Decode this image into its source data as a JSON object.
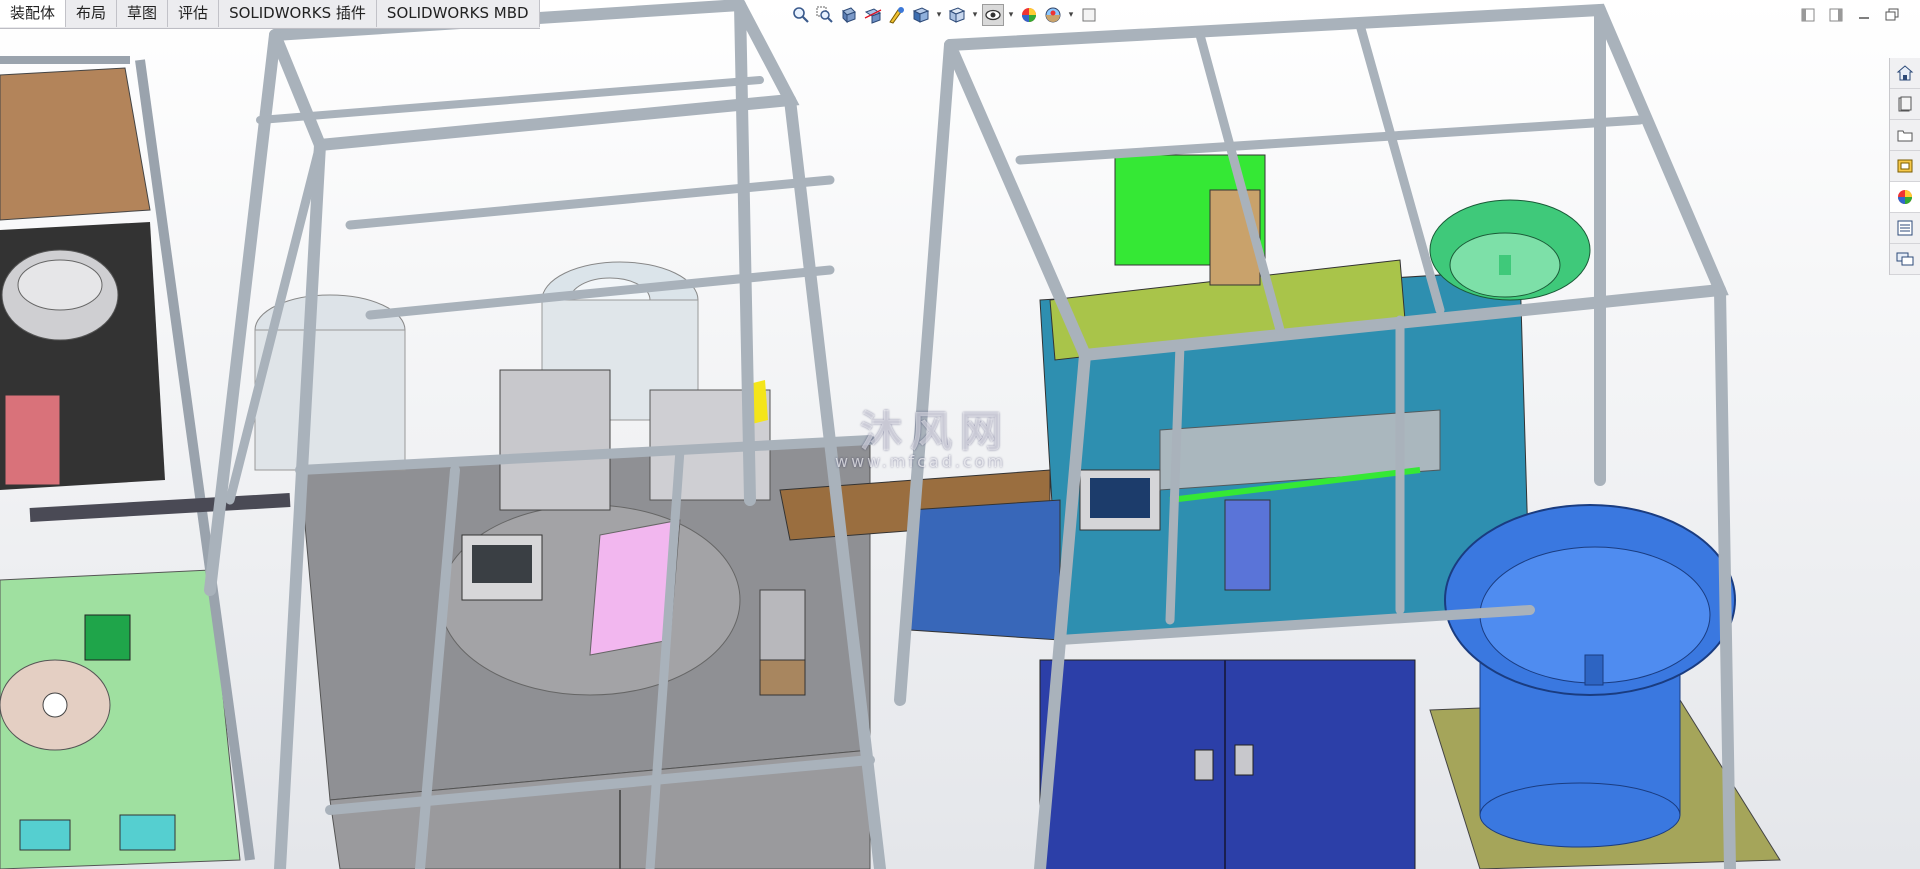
{
  "command_manager": {
    "tabs": [
      {
        "label": "装配体",
        "active": true
      },
      {
        "label": "布局"
      },
      {
        "label": "草图"
      },
      {
        "label": "评估"
      },
      {
        "label": "SOLIDWORKS 插件"
      },
      {
        "label": "SOLIDWORKS MBD"
      }
    ]
  },
  "heads_up_toolbar": {
    "icons": [
      "zoom-to-fit-icon",
      "zoom-to-area-icon",
      "previous-view-icon",
      "section-view-icon",
      "dynamic-annotation-icon",
      "view-orientation-icon",
      "display-style-icon",
      "hide-show-items-icon",
      "edit-appearance-icon",
      "apply-scene-icon",
      "view-settings-icon"
    ]
  },
  "task_pane": {
    "icons": [
      "home-icon",
      "design-library-icon",
      "file-explorer-icon",
      "view-palette-icon",
      "appearances-icon",
      "custom-properties-icon",
      "forum-icon"
    ]
  },
  "watermark": {
    "text": "沐风网",
    "url": "www.mfcad.com"
  },
  "colors": {
    "frame": "#a9b2bb",
    "panel_gray": "#8d8e91",
    "plate_teal": "#2e8fb0",
    "cabinet_blue": "#2c3fa8",
    "bowl_blue": "#3a78e0",
    "accent_green": "#35e835",
    "accent_yellowgreen": "#a9c44a",
    "copper_plate": "#b3845a",
    "olive_base": "#a5a55a"
  }
}
